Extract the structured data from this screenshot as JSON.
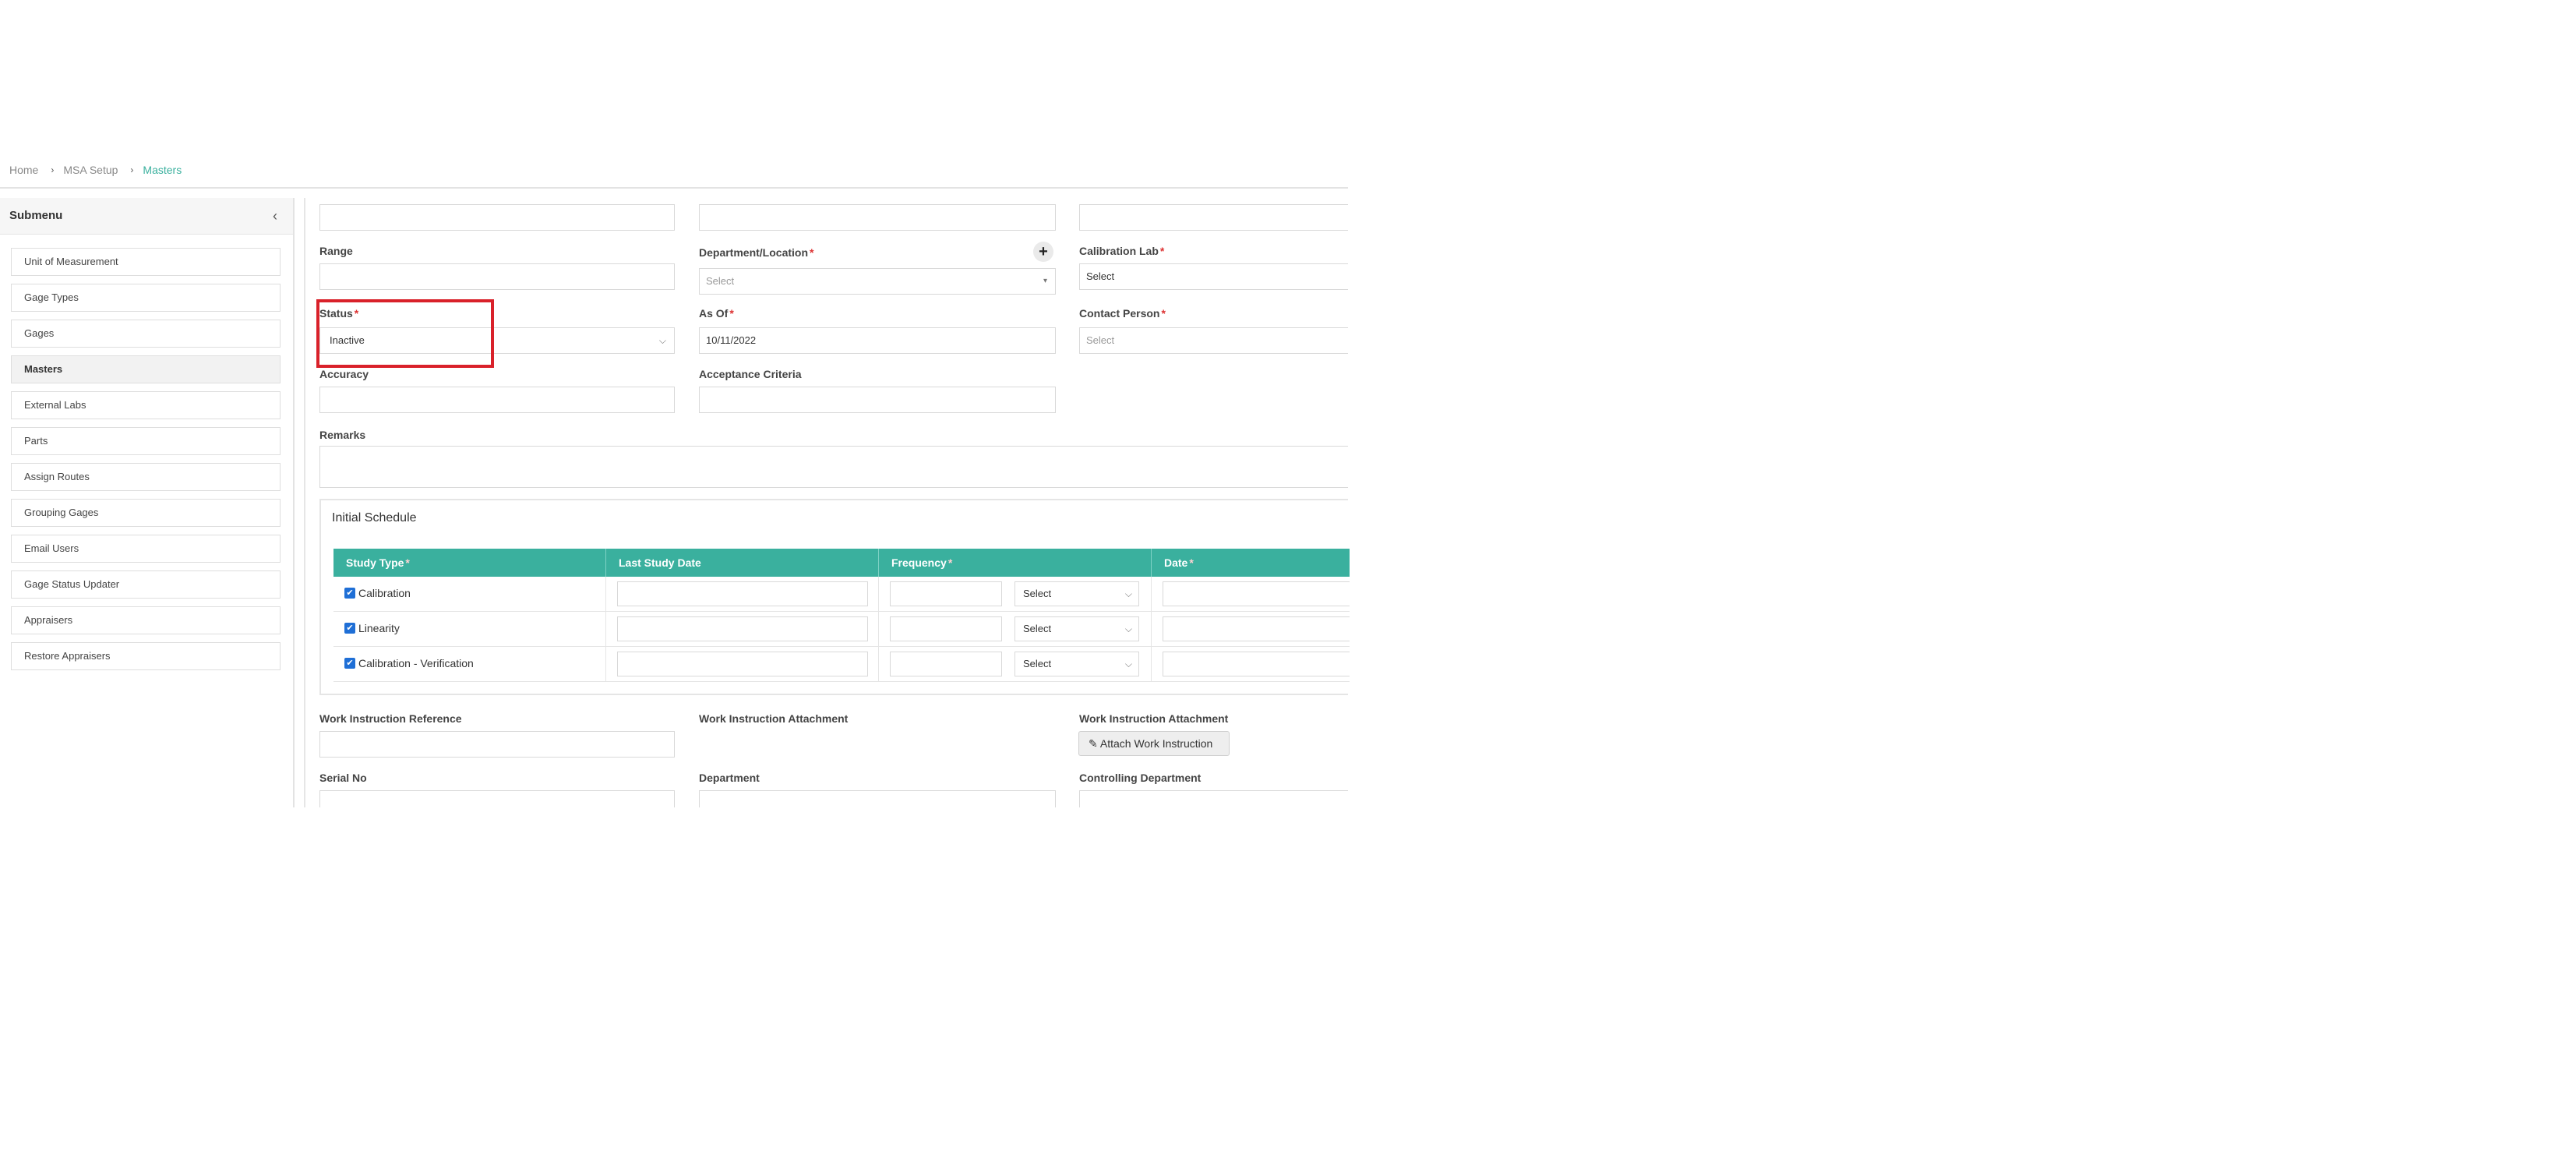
{
  "breadcrumb": {
    "home": "Home",
    "section": "MSA Setup",
    "current": "Masters",
    "sep": "›"
  },
  "sidebar": {
    "title": "Submenu",
    "collapse_icon": "‹",
    "items": [
      {
        "label": "Unit of Measurement",
        "active": false
      },
      {
        "label": "Gage Types",
        "active": false
      },
      {
        "label": "Gages",
        "active": false
      },
      {
        "label": "Masters",
        "active": true
      },
      {
        "label": "External Labs",
        "active": false
      },
      {
        "label": "Parts",
        "active": false
      },
      {
        "label": "Assign Routes",
        "active": false
      },
      {
        "label": "Grouping Gages",
        "active": false
      },
      {
        "label": "Email Users",
        "active": false
      },
      {
        "label": "Gage Status Updater",
        "active": false
      },
      {
        "label": "Appraisers",
        "active": false
      },
      {
        "label": "Restore Appraisers",
        "active": false
      }
    ]
  },
  "form": {
    "range": {
      "label": "Range"
    },
    "department_location": {
      "label": "Department/Location",
      "placeholder": "Select",
      "add_icon": "+"
    },
    "calibration_lab": {
      "label": "Calibration Lab",
      "value": "Select"
    },
    "status": {
      "label": "Status",
      "value": "Inactive"
    },
    "as_of": {
      "label": "As Of",
      "value": "10/11/2022"
    },
    "contact_person": {
      "label": "Contact Person",
      "placeholder": "Select"
    },
    "accuracy": {
      "label": "Accuracy"
    },
    "acceptance_criteria": {
      "label": "Acceptance Criteria"
    },
    "remarks": {
      "label": "Remarks"
    },
    "work_instruction_reference": {
      "label": "Work Instruction Reference"
    },
    "work_instruction_attachment": {
      "label": "Work Instruction Attachment"
    },
    "work_instruction_attachment_2": {
      "label": "Work Instruction Attachment",
      "button": "Attach Work Instruction",
      "icon": "✎"
    },
    "serial_no": {
      "label": "Serial No"
    },
    "department": {
      "label": "Department"
    },
    "controlling_department": {
      "label": "Controlling Department"
    },
    "required_mark": "*"
  },
  "schedule": {
    "title": "Initial Schedule",
    "columns": [
      "Study Type",
      "Last Study Date",
      "Frequency",
      "Date"
    ],
    "rows": [
      {
        "study_type": "Calibration",
        "frequency_unit": "Select"
      },
      {
        "study_type": "Linearity",
        "frequency_unit": "Select"
      },
      {
        "study_type": "Calibration - Verification",
        "frequency_unit": "Select"
      }
    ]
  },
  "icons": {
    "chevron": "⌵",
    "check": "✔"
  },
  "colors": {
    "accent": "#3ab09e",
    "highlight": "#d9212a",
    "required": "#d33333"
  }
}
